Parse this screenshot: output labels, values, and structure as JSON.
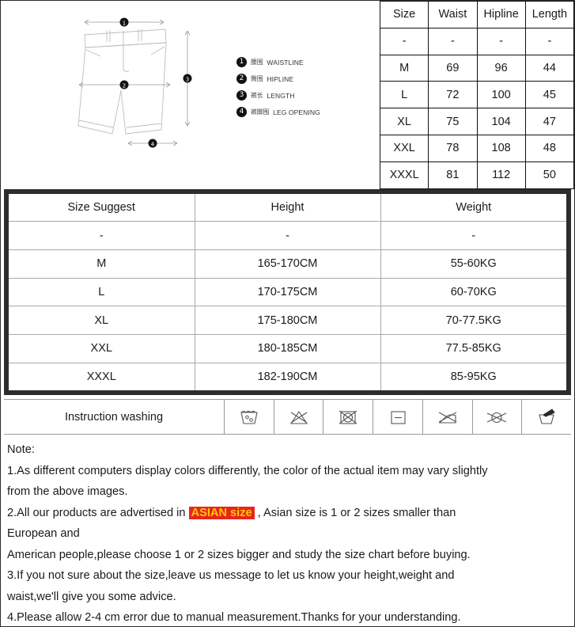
{
  "diagram": {
    "alt": "mens shorts technical flat drawing with measurement callouts",
    "callouts": [
      {
        "num": "1",
        "position": "waist-top"
      },
      {
        "num": "2",
        "position": "hip-middle"
      },
      {
        "num": "3",
        "position": "length-right"
      },
      {
        "num": "4",
        "position": "leg-opening-bottom"
      }
    ],
    "legend": [
      {
        "num": "1",
        "cn": "腰围",
        "en": "WAISTLINE"
      },
      {
        "num": "2",
        "cn": "臀围",
        "en": "HIPLINE"
      },
      {
        "num": "3",
        "cn": "裤长",
        "en": "LENGTH"
      },
      {
        "num": "4",
        "cn": "裤脚围",
        "en": "LEG OPENING"
      }
    ]
  },
  "measurement_table": {
    "headers": [
      "Size",
      "Waist",
      "Hipline",
      "Length"
    ],
    "rows": [
      [
        "-",
        "-",
        "-",
        "-"
      ],
      [
        "M",
        "69",
        "96",
        "44"
      ],
      [
        "L",
        "72",
        "100",
        "45"
      ],
      [
        "XL",
        "75",
        "104",
        "47"
      ],
      [
        "XXL",
        "78",
        "108",
        "48"
      ],
      [
        "XXXL",
        "81",
        "112",
        "50"
      ]
    ]
  },
  "suggest_table": {
    "headers": [
      "Size Suggest",
      "Height",
      "Weight"
    ],
    "rows": [
      [
        "-",
        "-",
        "-"
      ],
      [
        "M",
        "165-170CM",
        "55-60KG"
      ],
      [
        "L",
        "170-175CM",
        "60-70KG"
      ],
      [
        "XL",
        "175-180CM",
        "70-77.5KG"
      ],
      [
        "XXL",
        "180-185CM",
        "77.5-85KG"
      ],
      [
        "XXXL",
        "182-190CM",
        "85-95KG"
      ]
    ]
  },
  "washing": {
    "label": "Instruction washing",
    "icons": [
      "machine-wash-icon",
      "do-not-bleach-icon",
      "do-not-tumble-dry-icon",
      "dry-flat-icon",
      "do-not-iron-icon",
      "do-not-dry-clean-icon",
      "hand-wash-icon"
    ]
  },
  "notes": {
    "title": "Note:",
    "line1a": "1.As different computers display colors differently, the color of the actual item may vary slightly",
    "line1b": "from the above images.",
    "line2a": "2.All our products are advertised in ",
    "line2_highlight": "ASIAN size",
    "line2b": " , Asian size is 1 or 2 sizes smaller than",
    "line2c": "European and",
    "line2d": "American people,please choose 1 or 2 sizes bigger and study the size chart before buying.",
    "line3a": "3.If you not sure about the size,leave us message to let us know your height,weight and",
    "line3b": "waist,we'll give you some advice.",
    "line4": "4.Please allow 2-4 cm error due to manual measurement.Thanks for your understanding."
  },
  "colors": {
    "highlight_bg": "#e8251c",
    "highlight_text": "#ffc800",
    "table_border_dark": "#2d2d2d"
  }
}
